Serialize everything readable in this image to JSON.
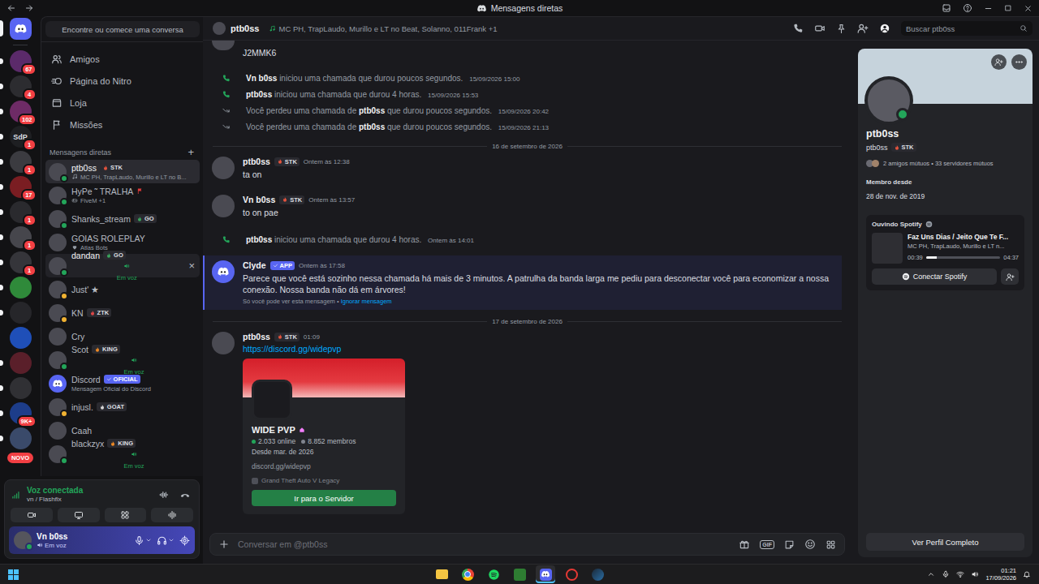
{
  "window": {
    "title": "Mensagens diretas"
  },
  "servers": [
    {
      "kind": "home",
      "selected": true,
      "unread": false
    },
    {
      "kind": "image",
      "selected": false,
      "unread": true,
      "color": "#5b2a6a",
      "badge": "67"
    },
    {
      "kind": "image",
      "selected": false,
      "unread": true,
      "color": "#2c2c30",
      "badge": "4"
    },
    {
      "kind": "image",
      "selected": false,
      "unread": true,
      "color": "#6e2b66",
      "badge": "102"
    },
    {
      "kind": "acronym",
      "selected": false,
      "unread": true,
      "acronym": "SdP",
      "color": "#1e1f22",
      "badge": "1"
    },
    {
      "kind": "image",
      "selected": false,
      "unread": true,
      "color": "#3b3b40",
      "badge": "1"
    },
    {
      "kind": "image",
      "selected": false,
      "unread": true,
      "color": "#7a1d22",
      "badge": "17"
    },
    {
      "kind": "image",
      "selected": false,
      "unread": true,
      "color": "#2a2a2e",
      "badge": "1"
    },
    {
      "kind": "image",
      "selected": false,
      "unread": true,
      "color": "#46464c",
      "badge": "1"
    },
    {
      "kind": "image",
      "selected": false,
      "unread": true,
      "color": "#35353a",
      "badge": "1"
    },
    {
      "kind": "image",
      "selected": false,
      "unread": true,
      "color": "#2f8a3a"
    },
    {
      "kind": "image",
      "selected": false,
      "unread": true,
      "color": "#26262a"
    },
    {
      "kind": "image",
      "selected": false,
      "unread": false,
      "color": "#1f4fb8"
    },
    {
      "kind": "image",
      "selected": false,
      "unread": true,
      "color": "#5a1f2a"
    },
    {
      "kind": "image",
      "selected": false,
      "unread": true,
      "color": "#303034"
    },
    {
      "kind": "image",
      "selected": false,
      "unread": true,
      "color": "#1d3d8a",
      "badge": "9K+"
    },
    {
      "kind": "image",
      "selected": false,
      "unread": true,
      "color": "#3a4a6a"
    }
  ],
  "server_new_label": "NOVO",
  "dm_panel": {
    "search": "Encontre ou comece uma conversa",
    "nav": [
      {
        "label": "Amigos",
        "kind": "friends"
      },
      {
        "label": "Página do Nitro",
        "kind": "nitro"
      },
      {
        "label": "Loja",
        "kind": "shop"
      },
      {
        "label": "Missões",
        "kind": "quests"
      }
    ],
    "header": "Mensagens diretas",
    "add": "+"
  },
  "dms": [
    {
      "name": "ptb0ss",
      "avatar_kind": "photo",
      "tag": {
        "label": "STK",
        "color": "#e5533d"
      },
      "subtitle": {
        "text": "MC PH, TrapLaudo, Murillo e LT no B...",
        "kind": "music"
      },
      "status": "online",
      "selected": true,
      "hovered": false,
      "flag": false
    },
    {
      "name": "HyPe ˜ TRALHA",
      "avatar_kind": "photo",
      "subtitle": {
        "text": "FiveM +1",
        "kind": "game"
      },
      "status": "online",
      "selected": false,
      "hovered": false,
      "flag": true
    },
    {
      "name": "Shanks_stream",
      "avatar_kind": "photo",
      "tag": {
        "label": "GO",
        "color": "#3ba55d"
      },
      "status": "online",
      "selected": false,
      "hovered": false,
      "flag": false
    },
    {
      "name": "GOIAS ROLEPLAY",
      "avatar_kind": "photo",
      "subtitle": {
        "text": "Atlas Bots",
        "kind": "heart"
      },
      "status": "offline",
      "selected": false,
      "hovered": false,
      "flag": false
    },
    {
      "name": "dandan",
      "avatar_kind": "photo",
      "tag": {
        "label": "GO",
        "color": "#3ba55d"
      },
      "subtitle": {
        "text": "Em voz",
        "kind": "voice"
      },
      "status": "online",
      "selected": false,
      "hovered": true,
      "close": "×",
      "flag": false
    },
    {
      "name": "Just' ★",
      "avatar_kind": "photo",
      "status": "idle",
      "selected": false,
      "hovered": false,
      "flag": false
    },
    {
      "name": "KN",
      "avatar_kind": "photo",
      "tag": {
        "label": "ZTK",
        "color": "#e04848"
      },
      "status": "idle",
      "selected": false,
      "hovered": false,
      "flag": false
    },
    {
      "name": "Cry",
      "avatar_kind": "photo",
      "status": "offline",
      "selected": false,
      "hovered": false,
      "flag": false
    },
    {
      "name": "Scot",
      "avatar_kind": "photo",
      "tag": {
        "label": "KING",
        "color": "#f08a24"
      },
      "subtitle": {
        "text": "Em voz",
        "kind": "voice"
      },
      "status": "online",
      "selected": false,
      "hovered": false,
      "flag": false
    },
    {
      "name": "Discord",
      "avatar_kind": "logo",
      "badge": {
        "label": "OFICIAL"
      },
      "subtitle": {
        "text": "Mensagem Oficial do Discord",
        "kind": "text"
      },
      "status": "offline",
      "selected": false,
      "hovered": false,
      "flag": false
    },
    {
      "name": "injusl.",
      "avatar_kind": "photo",
      "tag": {
        "label": "GOAT",
        "color": "#d8d8d8"
      },
      "status": "idle",
      "selected": false,
      "hovered": false,
      "flag": false
    },
    {
      "name": "Caah",
      "avatar_kind": "photo",
      "status": "offline",
      "selected": false,
      "hovered": false,
      "flag": false
    },
    {
      "name": "blackzyx",
      "avatar_kind": "photo",
      "tag": {
        "label": "KING",
        "color": "#f08a24"
      },
      "subtitle": {
        "text": "Em voz",
        "kind": "voice"
      },
      "status": "online",
      "selected": false,
      "hovered": false,
      "flag": false
    }
  ],
  "voice": {
    "title": "Voz conectada",
    "channel": "vn / Flashfix"
  },
  "user": {
    "name": "Vn b0ss",
    "status": "Em voz"
  },
  "chat_header": {
    "name": "ptb0ss",
    "activity": "MC PH, TrapLaudo, Murillo e LT no Beat, Solanno, 011Frank +1",
    "search": "Buscar ptb0ss"
  },
  "messages": [
    {
      "kind": "continued",
      "text": "J2MMK6"
    },
    {
      "kind": "call",
      "missed": false,
      "parts": [
        {
          "text": "Vn b0ss",
          "bold": true
        },
        {
          "text": " iniciou uma chamada que durou poucos segundos.",
          "bold": false
        }
      ],
      "time": "15/09/2026 15:00"
    },
    {
      "kind": "call",
      "missed": false,
      "parts": [
        {
          "text": "ptb0ss",
          "bold": true
        },
        {
          "text": " iniciou uma chamada que durou 4 horas.",
          "bold": false
        }
      ],
      "time": "15/09/2026 15:53"
    },
    {
      "kind": "call",
      "missed": true,
      "parts": [
        {
          "text": "Você perdeu uma chamada de ",
          "bold": false
        },
        {
          "text": "ptb0ss",
          "bold": true
        },
        {
          "text": " que durou poucos segundos.",
          "bold": false
        }
      ],
      "time": "15/09/2026 20:42"
    },
    {
      "kind": "call",
      "missed": true,
      "parts": [
        {
          "text": "Você perdeu uma chamada de ",
          "bold": false
        },
        {
          "text": "ptb0ss",
          "bold": true
        },
        {
          "text": " que durou poucos segundos.",
          "bold": false
        }
      ],
      "time": "15/09/2026 21:13"
    },
    {
      "kind": "divider",
      "text": "16 de setembro de 2026"
    },
    {
      "kind": "message",
      "author": "ptb0ss",
      "tag": {
        "label": "STK",
        "color": "#e5533d"
      },
      "time": "Ontem às 12:38",
      "text": "ta on"
    },
    {
      "kind": "message",
      "author": "Vn b0ss",
      "tag": {
        "label": "STK",
        "color": "#e5533d"
      },
      "time": "Ontem às 13:57",
      "text": "to on pae"
    },
    {
      "kind": "call",
      "missed": false,
      "parts": [
        {
          "text": "ptb0ss",
          "bold": true
        },
        {
          "text": " iniciou uma chamada que durou 4 horas.",
          "bold": false
        }
      ],
      "time": "Ontem às 14:01"
    },
    {
      "kind": "ephemeral",
      "author": "Clyde",
      "badge": "APP",
      "time": "Ontem às 17:58",
      "highlighted": true,
      "text": "Parece que você está sozinho nessa chamada há mais de 3 minutos. A patrulha da banda larga me pediu para desconectar você para economizar a nossa conexão. Nossa banda não dá em árvores!",
      "note": "Só você pode ver esta mensagem •",
      "dismiss": "Ignorar mensagem"
    },
    {
      "kind": "divider",
      "text": "17 de setembro de 2026"
    },
    {
      "kind": "invite",
      "author": "ptb0ss",
      "tag": {
        "label": "STK",
        "color": "#e5533d"
      },
      "time": "01:09",
      "link": "https://discord.gg/widepvp",
      "invite": {
        "name": "WIDE PVP",
        "online": "2.033 online",
        "members": "8.852 membros",
        "since": "Desde mar. de 2026",
        "url": "discord.gg/widepvp",
        "game": "Grand Theft Auto V Legacy",
        "button": "Ir para o Servidor"
      }
    }
  ],
  "composer": {
    "placeholder": "Conversar em @ptb0ss",
    "gif": "GIF"
  },
  "profile": {
    "display_name": "ptb0ss",
    "username": "ptb0ss",
    "tag": {
      "label": "STK",
      "color": "#e5533d"
    },
    "status": "online",
    "mutuals": "2 amigos mútuos • 33 servidores mútuos",
    "member_since_label": "Membro desde",
    "member_since": "28 de nov. de 2019",
    "spotify": {
      "title": "Ouvindo Spotify",
      "track": "Faz Uns Dias / Jeito Que Te F...",
      "artists": "MC PH, TrapLaudo, Murillo e LT n...",
      "elapsed": "00:39",
      "duration": "04:37",
      "level": 0.14,
      "button": "Conectar Spotify"
    },
    "full_profile": "Ver Perfil Completo"
  },
  "taskbar": {
    "apps": [
      {
        "kind": "explorer",
        "active": false
      },
      {
        "kind": "chrome",
        "active": false
      },
      {
        "kind": "spotify",
        "active": false
      },
      {
        "kind": "green",
        "active": false
      },
      {
        "kind": "discord",
        "active": true
      },
      {
        "kind": "red",
        "active": false
      },
      {
        "kind": "steam",
        "active": false
      }
    ],
    "time": "01:21",
    "date": "17/09/2026"
  }
}
